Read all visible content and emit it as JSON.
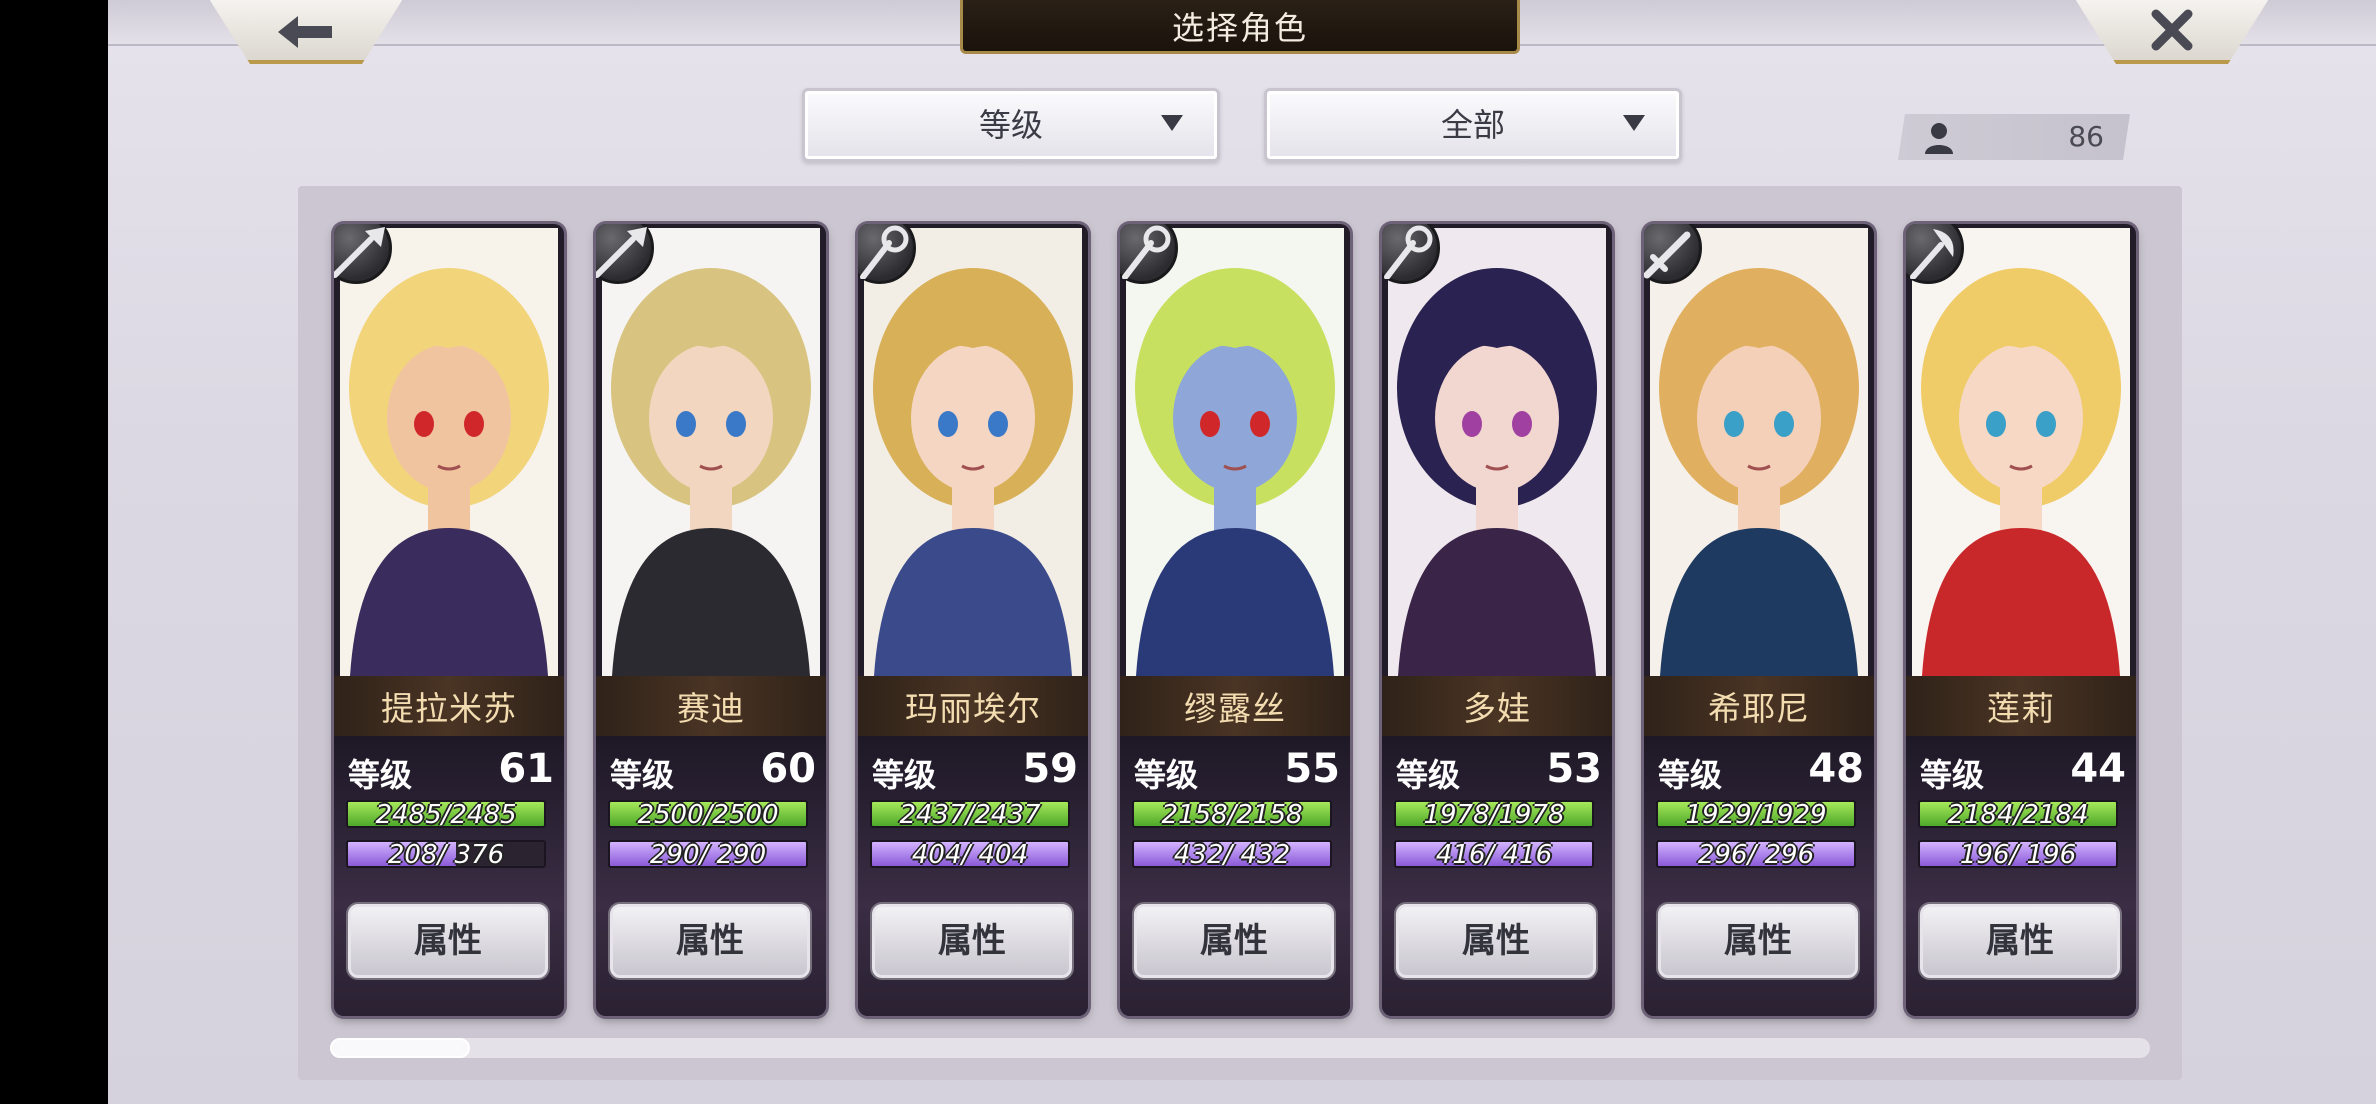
{
  "header": {
    "title": "选择角色",
    "back_icon": "arrow-left-icon",
    "close_icon": "close-icon"
  },
  "filters": {
    "sort_value": "等级",
    "filter_value": "全部"
  },
  "roster_count": "86",
  "attr_button_label": "属性",
  "level_label": "等级",
  "colors": {
    "hp_bar": "#6cc63a",
    "mp_bar": "#a57be6",
    "name_text": "#f3dcb0",
    "title_bg": "#1a130c",
    "gold_trim": "#b89a4a"
  },
  "characters": [
    {
      "name": "提拉米苏",
      "level": "61",
      "hp": "2485/2485",
      "hp_ratio": 1.0,
      "mp": "208/  376",
      "mp_ratio": 0.553,
      "weapon": "spear-icon"
    },
    {
      "name": "赛迪",
      "level": "60",
      "hp": "2500/2500",
      "hp_ratio": 1.0,
      "mp": "290/  290",
      "mp_ratio": 1.0,
      "weapon": "spear-icon"
    },
    {
      "name": "玛丽埃尔",
      "level": "59",
      "hp": "2437/2437",
      "hp_ratio": 1.0,
      "mp": "404/  404",
      "mp_ratio": 1.0,
      "weapon": "staff-icon"
    },
    {
      "name": "缪露丝",
      "level": "55",
      "hp": "2158/2158",
      "hp_ratio": 1.0,
      "mp": "432/  432",
      "mp_ratio": 1.0,
      "weapon": "staff-icon"
    },
    {
      "name": "多娃",
      "level": "53",
      "hp": "1978/1978",
      "hp_ratio": 1.0,
      "mp": "416/  416",
      "mp_ratio": 1.0,
      "weapon": "staff-icon"
    },
    {
      "name": "希耶尼",
      "level": "48",
      "hp": "1929/1929",
      "hp_ratio": 1.0,
      "mp": "296/  296",
      "mp_ratio": 1.0,
      "weapon": "sword-icon"
    },
    {
      "name": "莲莉",
      "level": "44",
      "hp": "2184/2184",
      "hp_ratio": 1.0,
      "mp": "196/  196",
      "mp_ratio": 1.0,
      "weapon": "axe-icon"
    }
  ]
}
